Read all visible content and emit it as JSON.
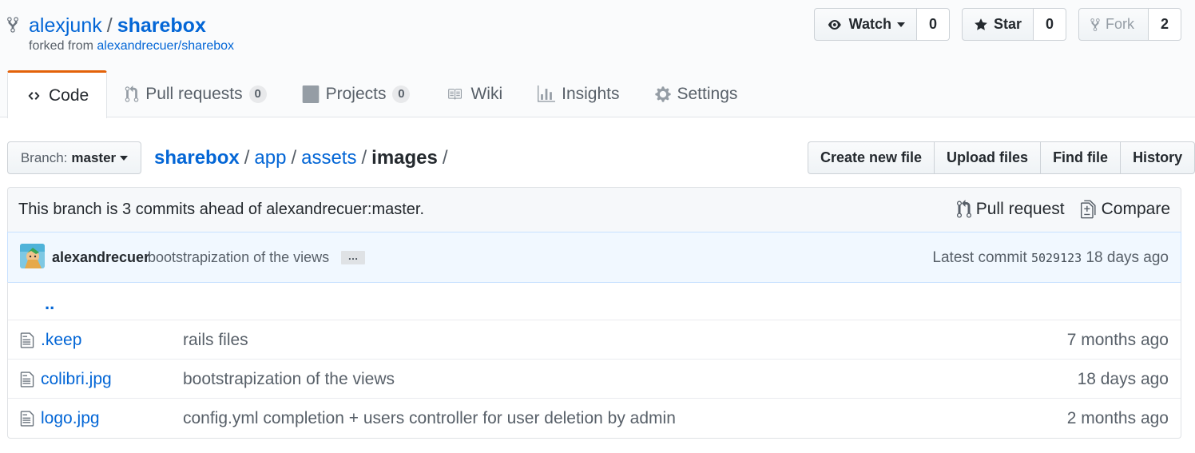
{
  "repo": {
    "owner": "alexjunk",
    "separator": "/",
    "name": "sharebox",
    "forked_prefix": "forked from",
    "forked_source": "alexandrecuer/sharebox"
  },
  "actions": {
    "watch": {
      "label": "Watch",
      "count": "0"
    },
    "star": {
      "label": "Star",
      "count": "0"
    },
    "fork": {
      "label": "Fork",
      "count": "2"
    }
  },
  "tabs": [
    {
      "label": "Code",
      "icon": "code-icon",
      "selected": true
    },
    {
      "label": "Pull requests",
      "count": "0",
      "icon": "git-pull-request-icon"
    },
    {
      "label": "Projects",
      "count": "0",
      "icon": "project-icon"
    },
    {
      "label": "Wiki",
      "icon": "book-icon"
    },
    {
      "label": "Insights",
      "icon": "graph-icon"
    },
    {
      "label": "Settings",
      "icon": "gear-icon"
    }
  ],
  "branch": {
    "prefix": "Branch:",
    "name": "master"
  },
  "breadcrumb": {
    "items": [
      "sharebox",
      "app",
      "assets"
    ],
    "final": "images",
    "separator": "/"
  },
  "file_buttons": {
    "create": "Create new file",
    "upload": "Upload files",
    "find": "Find file",
    "history": "History"
  },
  "branch_info": {
    "message": "This branch is 3 commits ahead of alexandrecuer:master.",
    "pull_request": "Pull request",
    "compare": "Compare"
  },
  "commit": {
    "author": "alexandrecuer",
    "message": "bootstrapization of the views",
    "ellipsis": "…",
    "latest_label": "Latest commit",
    "sha": "5029123",
    "age": "18 days ago"
  },
  "up_tree": "..",
  "files": [
    {
      "name": ".keep",
      "message": "rails files",
      "age": "7 months ago"
    },
    {
      "name": "colibri.jpg",
      "message": "bootstrapization of the views",
      "age": "18 days ago"
    },
    {
      "name": "logo.jpg",
      "message": "config.yml completion + users controller for user deletion by admin",
      "age": "2 months ago"
    }
  ],
  "colors": {
    "link": "#0366d6",
    "text": "#24292e",
    "muted": "#586069",
    "tab_accent": "#e36209",
    "commit_bg": "#f1f8ff"
  }
}
